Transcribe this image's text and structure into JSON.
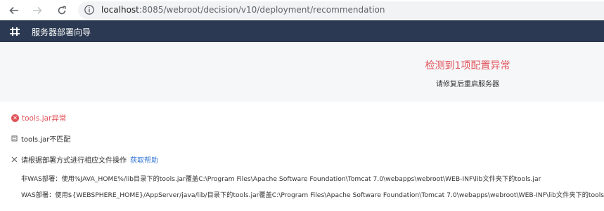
{
  "browser": {
    "url_host": "localhost",
    "url_rest": ":8085/webroot/decision/v10/deployment/recommendation"
  },
  "header": {
    "title": "服务器部署向导"
  },
  "summary": {
    "title": "检测到1项配置异常",
    "subtitle": "请修复后重启服务器"
  },
  "issue": {
    "title": "tools.jar异常",
    "mismatch": "tools.jar不匹配",
    "hint": "请根据部署方式进行相应文件操作",
    "help_link": "获取帮助",
    "instructions": [
      "非WAS部署：使用%JAVA_HOME%/lib目录下的tools.jar覆盖C:\\Program Files\\Apache Software Foundation\\Tomcat 7.0\\webapps\\webroot\\WEB-INF\\lib文件夹下的tools.jar",
      "WAS部署：使用${WEBSPHERE_HOME}/AppServer/java/lib/目录下的tools.jar覆盖C:\\Program Files\\Apache Software Foundation\\Tomcat 7.0\\webapps\\webroot\\WEB-INF\\lib文件夹下的tools.jar"
    ]
  },
  "colors": {
    "header_bg": "#2b3a52",
    "error": "#e0535a",
    "link": "#3a7bd5"
  }
}
